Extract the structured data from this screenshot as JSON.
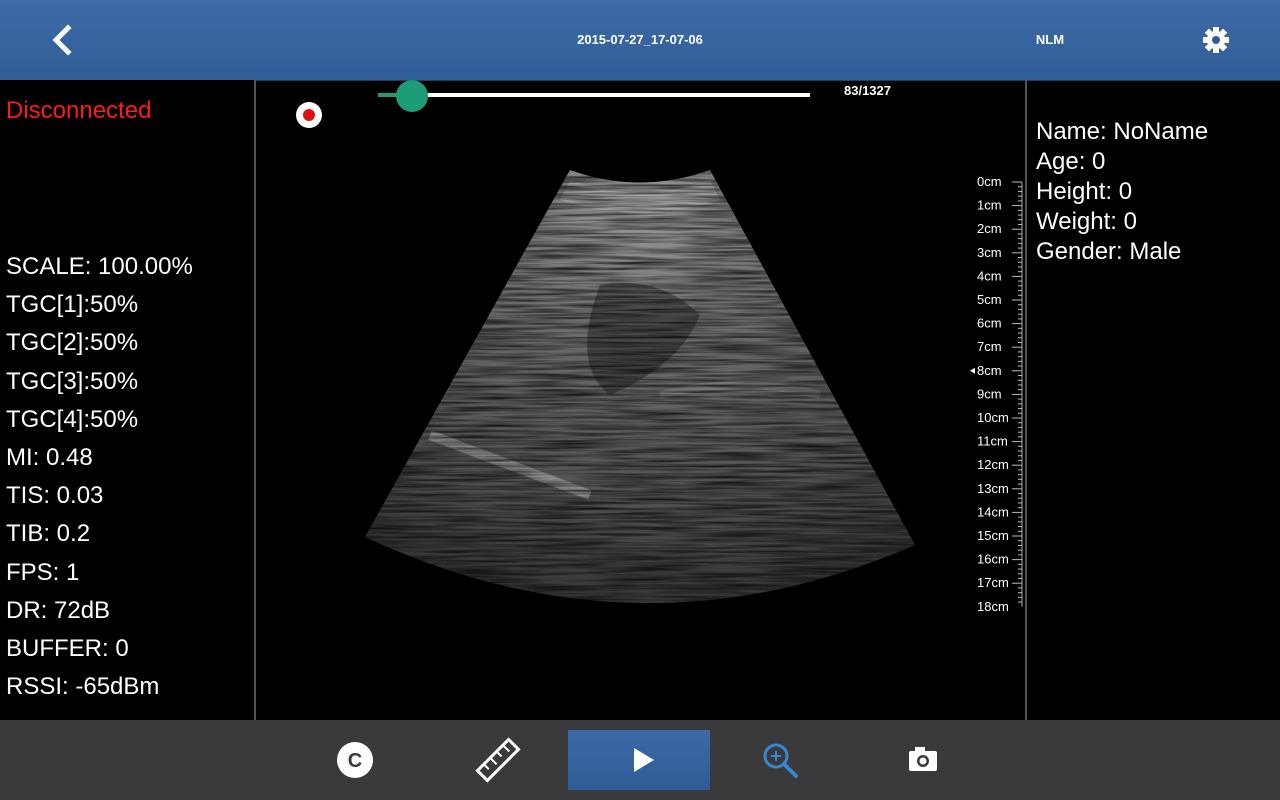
{
  "header": {
    "title": "2015-07-27_17-07-06",
    "user": "NLM"
  },
  "status": {
    "connection": "Disconnected",
    "color": "#ff1a1a"
  },
  "parameters": [
    "SCALE: 100.00%",
    "TGC[1]:50%",
    "TGC[2]:50%",
    "TGC[3]:50%",
    "TGC[4]:50%",
    "MI: 0.48",
    "TIS: 0.03",
    "TIB: 0.2",
    "FPS: 1",
    "DR: 72dB",
    "BUFFER: 0",
    "RSSI: -65dBm"
  ],
  "patient": {
    "name": "Name: NoName",
    "age": "Age: 0",
    "height": "Height: 0",
    "weight": "Weight: 0",
    "gender": "Gender: Male"
  },
  "playback": {
    "frame_label": "83/1327",
    "current_frame": 83,
    "total_frames": 1327,
    "accent": "#1e9b77"
  },
  "depth_scale": {
    "labels": [
      "0cm",
      "1cm",
      "2cm",
      "3cm",
      "4cm",
      "5cm",
      "6cm",
      "7cm",
      "8cm",
      "9cm",
      "10cm",
      "11cm",
      "12cm",
      "13cm",
      "14cm",
      "15cm",
      "16cm",
      "17cm",
      "18cm"
    ],
    "marker_depth_cm": 8
  },
  "toolbar": {
    "buttons": [
      "c-icon",
      "ruler-icon",
      "play-icon",
      "zoom-in-icon",
      "camera-icon"
    ],
    "active_color": "#2f5d98",
    "zoom_color": "#3a86d1"
  }
}
